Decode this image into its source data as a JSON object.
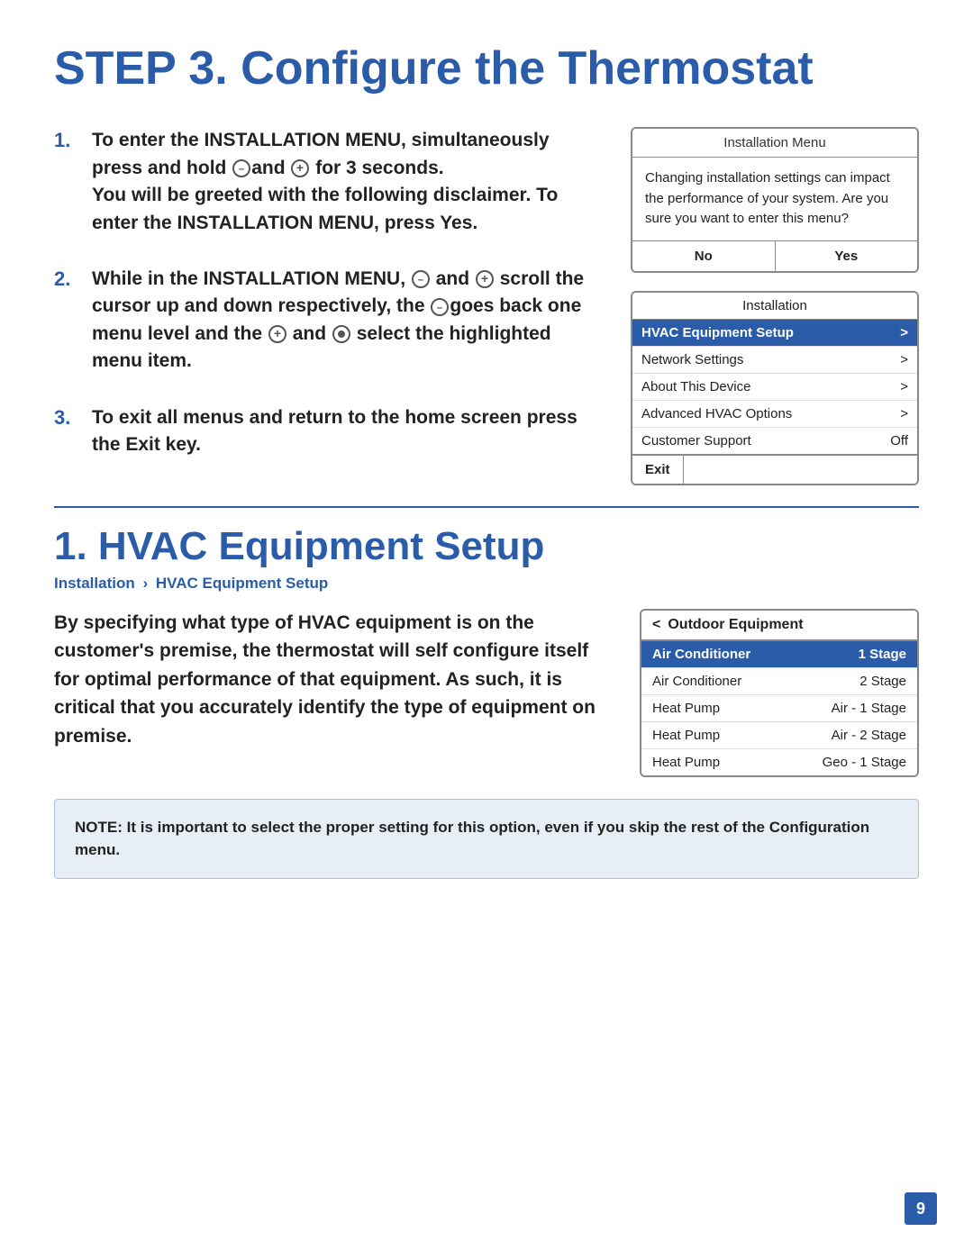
{
  "page": {
    "title": "STEP 3. Configure the Thermostat",
    "page_number": "9"
  },
  "steps": [
    {
      "num": "1.",
      "text": "To enter the INSTALLATION MENU, simultaneously press and hold",
      "text2": "and",
      "text3": "for 3 seconds.",
      "text4": "You will be greeted with the following disclaimer. To enter the INSTALLATION MENU, press Yes."
    },
    {
      "num": "2.",
      "text": "While in the INSTALLATION MENU,",
      "text2": "and",
      "text3": "scroll the cursor up and down respectively, the",
      "text4": "goes back one menu level and the",
      "text5": "and",
      "text6": "select the highlighted menu item."
    },
    {
      "num": "3.",
      "text": "To exit all menus and return to the home screen press the Exit key."
    }
  ],
  "installation_menu_panel": {
    "title": "Installation Menu",
    "body": "Changing installation settings can impact the performance of your system. Are you sure you want to enter this menu?",
    "btn_no": "No",
    "btn_yes": "Yes"
  },
  "installation_panel": {
    "title": "Installation",
    "rows": [
      {
        "label": "HVAC Equipment Setup",
        "value": ">",
        "highlighted": true
      },
      {
        "label": "Network Settings",
        "value": ">",
        "highlighted": false
      },
      {
        "label": "About This Device",
        "value": ">",
        "highlighted": false
      },
      {
        "label": "Advanced HVAC Options",
        "value": ">",
        "highlighted": false
      },
      {
        "label": "Customer Support",
        "value": "Off",
        "highlighted": false
      }
    ],
    "exit_btn": "Exit"
  },
  "hvac_section": {
    "title": "1. HVAC Equipment Setup",
    "breadcrumb_part1": "Installation",
    "breadcrumb_separator": ">",
    "breadcrumb_part2": "HVAC Equipment Setup",
    "body": "By specifying what type of HVAC equipment is on the customer's premise, the thermostat will self configure itself for optimal performance of that equipment. As such, it is critical that you accurately identify the type of equipment on premise."
  },
  "outdoor_panel": {
    "header_back": "<",
    "header_title": "Outdoor Equipment",
    "rows": [
      {
        "label": "Air Conditioner",
        "value": "1 Stage",
        "highlighted": true
      },
      {
        "label": "Air Conditioner",
        "value": "2 Stage",
        "highlighted": false
      },
      {
        "label": "Heat Pump",
        "value": "Air - 1 Stage",
        "highlighted": false
      },
      {
        "label": "Heat Pump",
        "value": "Air - 2 Stage",
        "highlighted": false
      },
      {
        "label": "Heat Pump",
        "value": "Geo - 1 Stage",
        "highlighted": false
      }
    ]
  },
  "note": {
    "text": "NOTE: It is important to select the proper setting for this option, even if you skip the rest of the Configuration menu."
  }
}
